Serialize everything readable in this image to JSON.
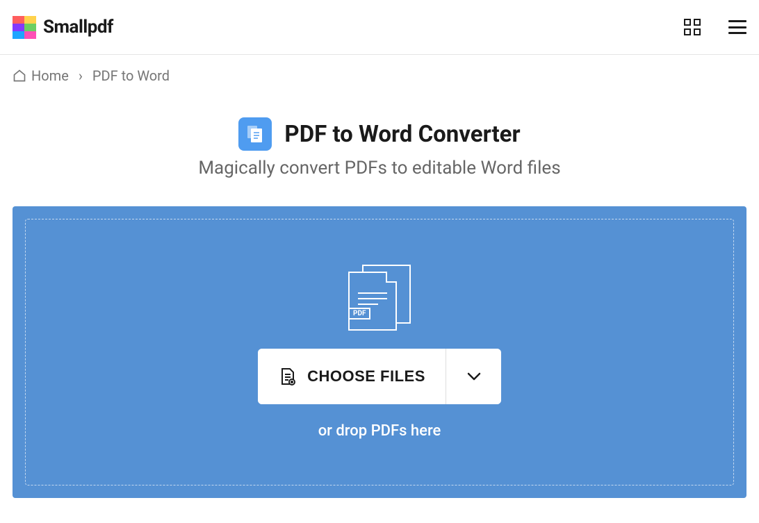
{
  "header": {
    "brand": "Smallpdf"
  },
  "breadcrumb": {
    "home_label": "Home",
    "separator": "›",
    "current": "PDF to Word"
  },
  "page": {
    "title": "PDF to Word Converter",
    "subtitle": "Magically convert PDFs to editable Word files"
  },
  "uploader": {
    "pdf_badge": "PDF",
    "choose_label": "CHOOSE FILES",
    "drop_hint": "or drop PDFs here"
  }
}
